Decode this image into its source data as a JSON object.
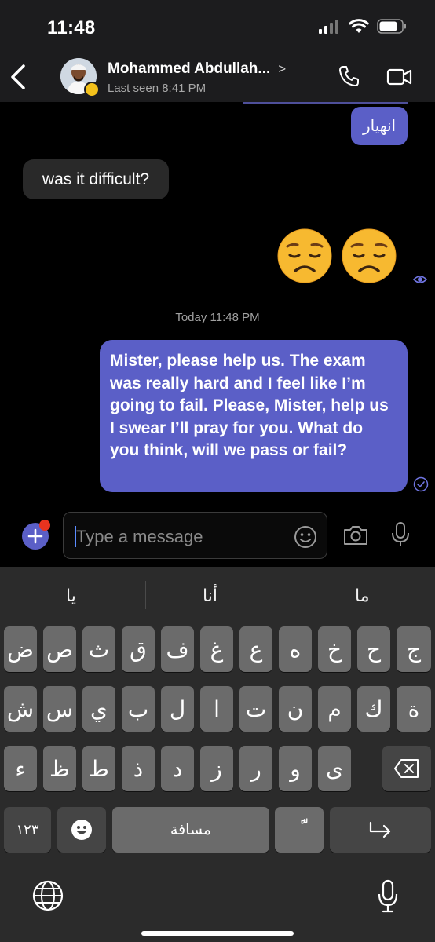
{
  "status_bar": {
    "time": "11:48"
  },
  "header": {
    "contact_name": "Mohammed Abdullah...",
    "chevron": ">",
    "last_seen": "Last seen 8:41 PM"
  },
  "messages": {
    "out_small": "انهيار",
    "in_1": "was it difficult?",
    "emoji_1": "😞",
    "emoji_2": "😞",
    "timestamp": "Today 11:48 PM",
    "out_big": "Mister, please help us. The exam was really hard and I feel like I’m going to fail. Please, Mister, help us  I swear I’ll pray for you. What do you think, will we pass or fail?"
  },
  "composer": {
    "placeholder": "Type a message"
  },
  "keyboard": {
    "suggestions": [
      "يا",
      "أنا",
      "ما"
    ],
    "row1": [
      "ض",
      "ص",
      "ث",
      "ق",
      "ف",
      "غ",
      "ع",
      "ه",
      "خ",
      "ح",
      "ج"
    ],
    "row2": [
      "ش",
      "س",
      "ي",
      "ب",
      "ل",
      "ا",
      "ت",
      "ن",
      "م",
      "ك",
      "ة"
    ],
    "row3": [
      "ء",
      "ظ",
      "ط",
      "ذ",
      "د",
      "ز",
      "ر",
      "و",
      "ى"
    ],
    "numbers_key": "١٢٣",
    "space_key": "مسافة",
    "tanween_key": "ًّ"
  },
  "colors": {
    "accent": "#5b5fc7",
    "incoming_bubble": "#292929",
    "notification_dot": "#e8331f",
    "presence_away": "#f3c11b"
  }
}
